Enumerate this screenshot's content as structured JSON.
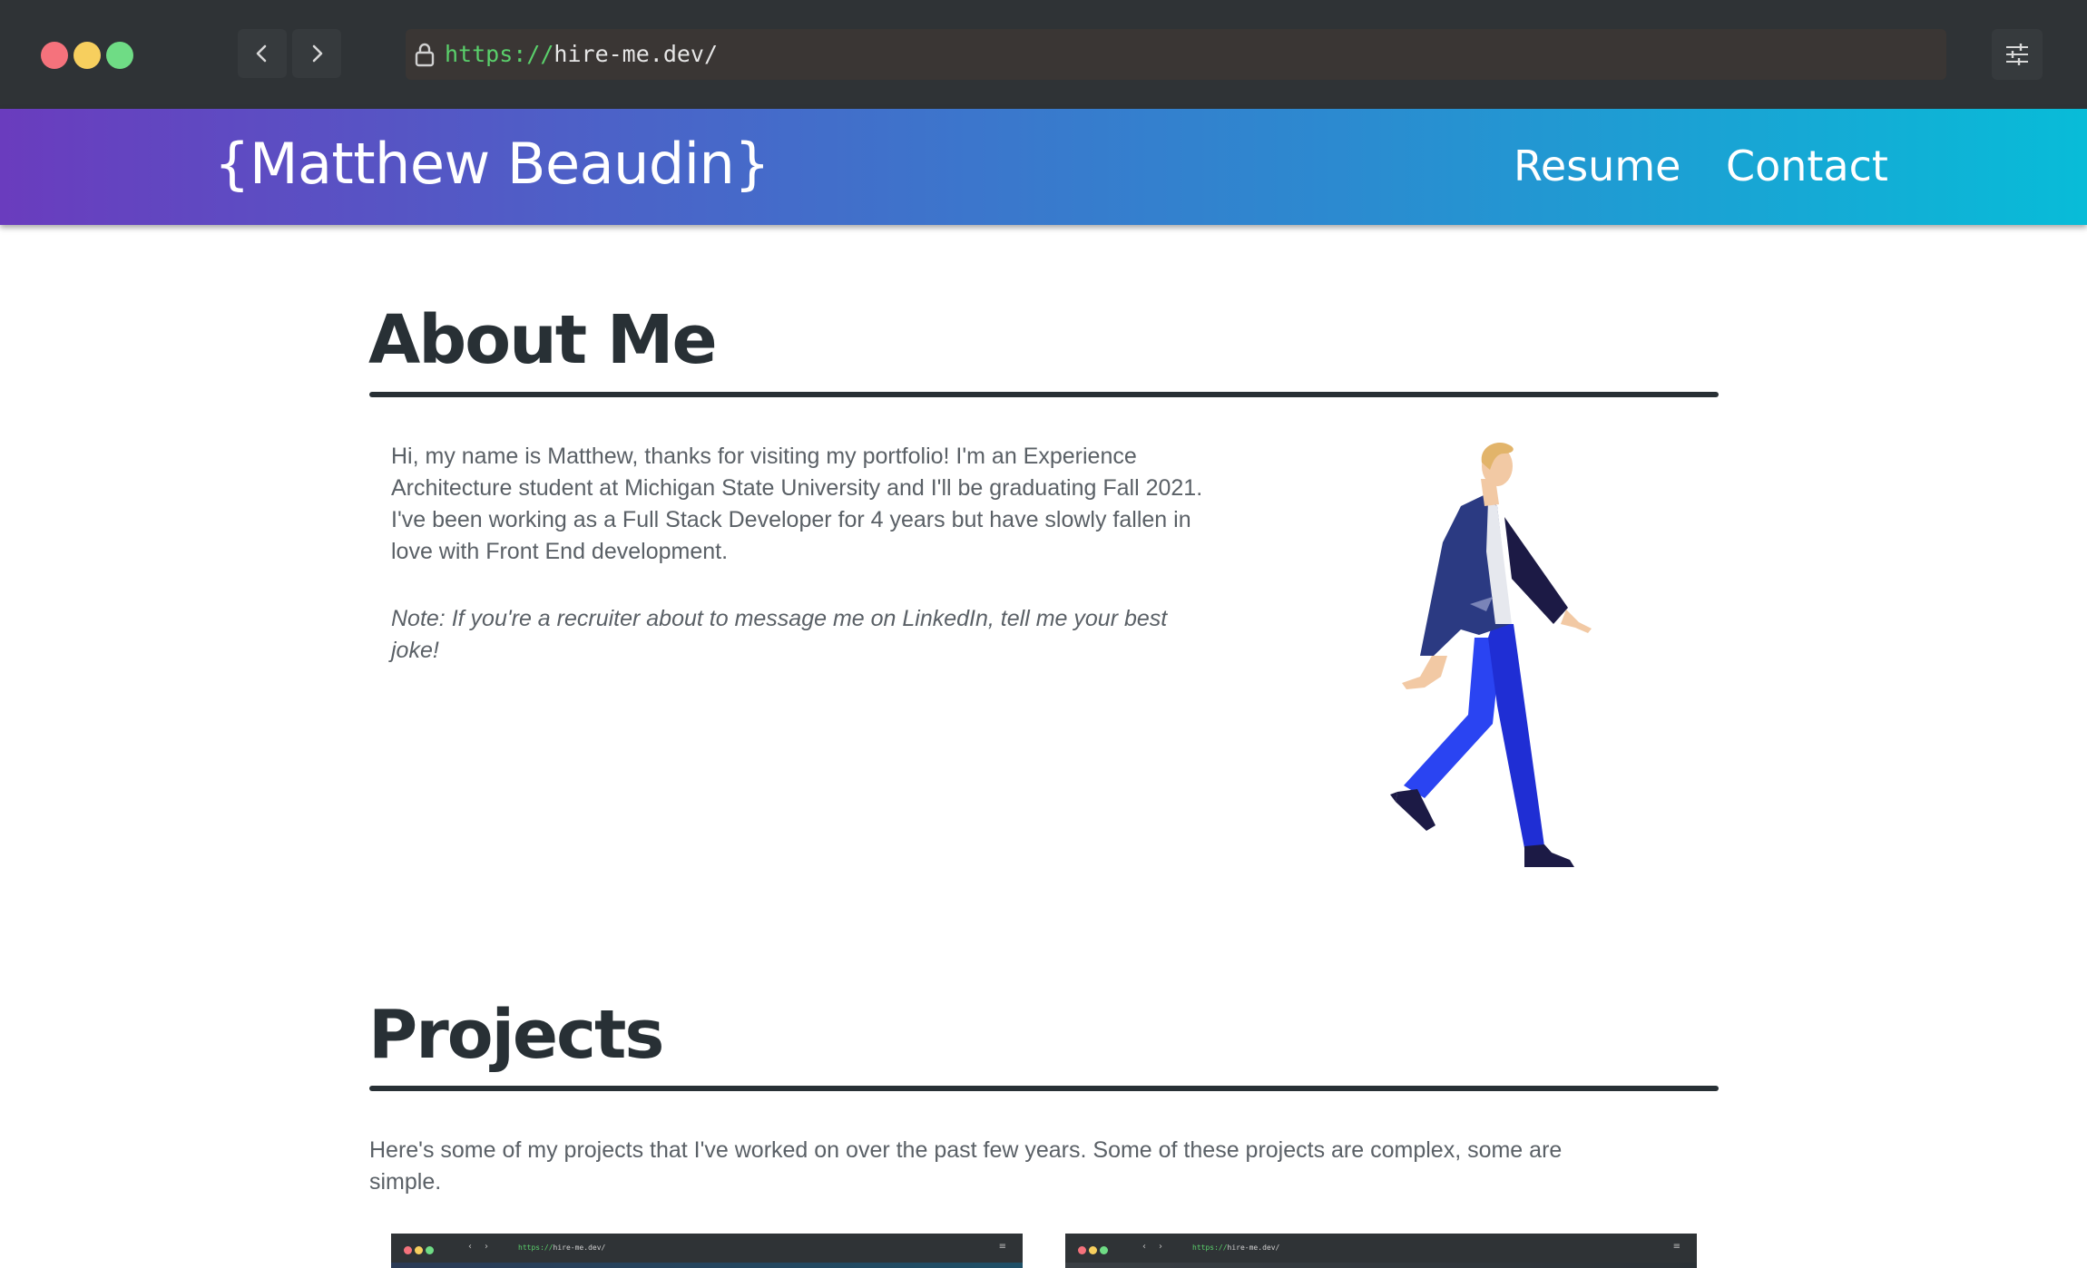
{
  "browser": {
    "url_scheme": "https://",
    "url_rest": "hire-me.dev/",
    "back_icon": "chevron-left-icon",
    "forward_icon": "chevron-right-icon",
    "settings_icon": "sliders-icon"
  },
  "header": {
    "brand": "{Matthew Beaudin}",
    "nav": [
      "Resume",
      "Contact"
    ]
  },
  "about": {
    "title": "About Me",
    "paragraph1_lines": [
      "Hi, my name is Matthew, thanks for visiting my portfolio! I'm an Experience",
      "Architecture student at Michigan State University and I'll be graduating Fall 2021.",
      "I've been working as a Full Stack Developer for 4 years but have slowly fallen in",
      "love with Front End development."
    ],
    "note_lines": [
      "Note: If you're a recruiter about to message me on LinkedIn, tell me your best",
      "joke!"
    ],
    "illustration": "walking-man-illustration"
  },
  "projects": {
    "title": "Projects",
    "intro_lines": [
      "Here's some of my projects that I've worked on over the past few years. Some of these projects are complex, some are",
      "simple."
    ],
    "thumbnails": [
      {
        "url_scheme": "https://",
        "url_rest": "hire-me.dev/"
      },
      {
        "url_scheme": "https://",
        "url_rest": "hire-me.dev/"
      }
    ]
  },
  "colors": {
    "chrome_bg": "#2f3336",
    "gradient_start": "#6a3cbe",
    "gradient_end": "#08bcd8",
    "heading": "#283035",
    "body_text": "#5a6066",
    "url_scheme": "#5ad06b"
  }
}
